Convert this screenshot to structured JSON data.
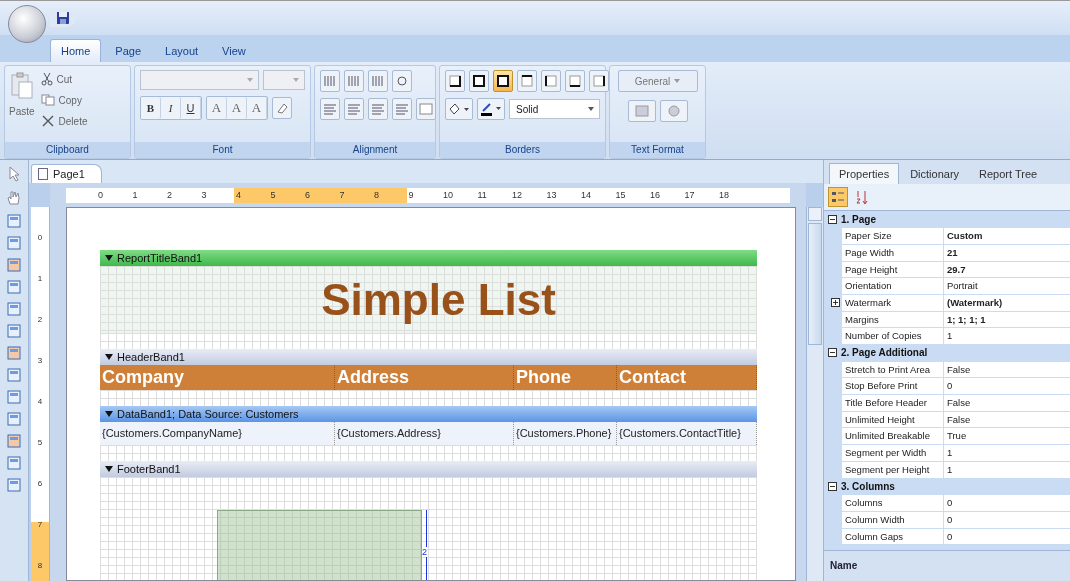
{
  "ribbon": {
    "tabs": [
      {
        "label": "Home",
        "selected": true
      },
      {
        "label": "Page",
        "selected": false
      },
      {
        "label": "Layout",
        "selected": false
      },
      {
        "label": "View",
        "selected": false
      }
    ],
    "clipboard": {
      "label": "Clipboard",
      "paste": "Paste",
      "cut": "Cut",
      "copy": "Copy",
      "delete": "Delete"
    },
    "font": {
      "label": "Font",
      "style_buttons": [
        "B",
        "I",
        "U"
      ],
      "size_buttons": [
        "A",
        "A",
        "A"
      ]
    },
    "alignment": {
      "label": "Alignment"
    },
    "borders": {
      "label": "Borders",
      "line_style": "Solid",
      "border_buttons": [
        {
          "selected": false
        },
        {
          "selected": false
        },
        {
          "selected": true
        },
        {
          "selected": false
        },
        {
          "selected": false
        },
        {
          "selected": false
        },
        {
          "selected": false
        }
      ]
    },
    "text_format": {
      "label": "Text Format",
      "format": "General"
    }
  },
  "document_tabs": [
    {
      "label": "Page1",
      "selected": true
    }
  ],
  "rulers": {
    "horizontal": [
      {
        "label": "0",
        "highlighted": false
      },
      {
        "label": "1",
        "highlighted": false
      },
      {
        "label": "2",
        "highlighted": false
      },
      {
        "label": "3",
        "highlighted": false
      },
      {
        "label": "4",
        "highlighted": true
      },
      {
        "label": "5",
        "highlighted": true
      },
      {
        "label": "6",
        "highlighted": true
      },
      {
        "label": "7",
        "highlighted": true
      },
      {
        "label": "8",
        "highlighted": true
      },
      {
        "label": "9",
        "highlighted": false
      },
      {
        "label": "10",
        "highlighted": false
      },
      {
        "label": "11",
        "highlighted": false
      },
      {
        "label": "12",
        "highlighted": false
      },
      {
        "label": "13",
        "highlighted": false
      },
      {
        "label": "14",
        "highlighted": false
      },
      {
        "label": "15",
        "highlighted": false
      },
      {
        "label": "16",
        "highlighted": false
      },
      {
        "label": "17",
        "highlighted": false
      },
      {
        "label": "18",
        "highlighted": false
      }
    ],
    "vertical": [
      {
        "label": "0",
        "highlighted": false
      },
      {
        "label": "1",
        "highlighted": false
      },
      {
        "label": "2",
        "highlighted": false
      },
      {
        "label": "3",
        "highlighted": false
      },
      {
        "label": "4",
        "highlighted": false
      },
      {
        "label": "5",
        "highlighted": false
      },
      {
        "label": "6",
        "highlighted": false
      },
      {
        "label": "7",
        "highlighted": true
      },
      {
        "label": "8",
        "highlighted": true
      }
    ]
  },
  "report": {
    "bands": [
      {
        "kind": "title",
        "name": "ReportTitleBand1",
        "title": "Simple List"
      },
      {
        "kind": "header",
        "name": "HeaderBand1",
        "cells": [
          "Company",
          "Address",
          "Phone",
          "Contact"
        ]
      },
      {
        "kind": "data",
        "name": "DataBand1; Data Source: Customers",
        "cells": [
          "{Customers.CompanyName}",
          "{Customers.Address}",
          "{Customers.Phone}",
          "{Customers.ContactTitle}"
        ]
      },
      {
        "kind": "footer",
        "name": "FooterBand1",
        "dimension": "2"
      }
    ]
  },
  "properties_panel": {
    "tabs": [
      {
        "label": "Properties",
        "selected": true
      },
      {
        "label": "Dictionary",
        "selected": false
      },
      {
        "label": "Report Tree",
        "selected": false
      }
    ],
    "view_buttons": [
      {
        "kind": "categorized",
        "selected": true
      },
      {
        "kind": "sorted",
        "selected": false
      }
    ],
    "categories": [
      {
        "name": "1. Page",
        "expanded": true,
        "rows": [
          {
            "name": "Paper Size",
            "value": "Custom",
            "modified": true
          },
          {
            "name": "Page Width",
            "value": "21",
            "modified": true
          },
          {
            "name": "Page Height",
            "value": "29.7",
            "modified": true
          },
          {
            "name": "Orientation",
            "value": "Portrait",
            "modified": false
          },
          {
            "name": "Watermark",
            "value": "(Watermark)",
            "modified": true,
            "expandable": true
          },
          {
            "name": "Margins",
            "value": "1; 1; 1; 1",
            "modified": true
          },
          {
            "name": "Number of Copies",
            "value": "1",
            "modified": false
          }
        ]
      },
      {
        "name": "2. Page Additional",
        "expanded": true,
        "rows": [
          {
            "name": "Stretch to Print Area",
            "value": "False",
            "modified": false
          },
          {
            "name": "Stop Before Print",
            "value": "0",
            "modified": false
          },
          {
            "name": "Title Before Header",
            "value": "False",
            "modified": false
          },
          {
            "name": "Unlimited Height",
            "value": "False",
            "modified": false
          },
          {
            "name": "Unlimited Breakable",
            "value": "True",
            "modified": false
          },
          {
            "name": "Segment per Width",
            "value": "1",
            "modified": false
          },
          {
            "name": "Segment per Height",
            "value": "1",
            "modified": false
          }
        ]
      },
      {
        "name": "3. Columns",
        "expanded": true,
        "rows": [
          {
            "name": "Columns",
            "value": "0",
            "modified": false
          },
          {
            "name": "Column Width",
            "value": "0",
            "modified": false
          },
          {
            "name": "Column Gaps",
            "value": "0",
            "modified": false
          }
        ]
      }
    ],
    "description_title": "Name"
  }
}
